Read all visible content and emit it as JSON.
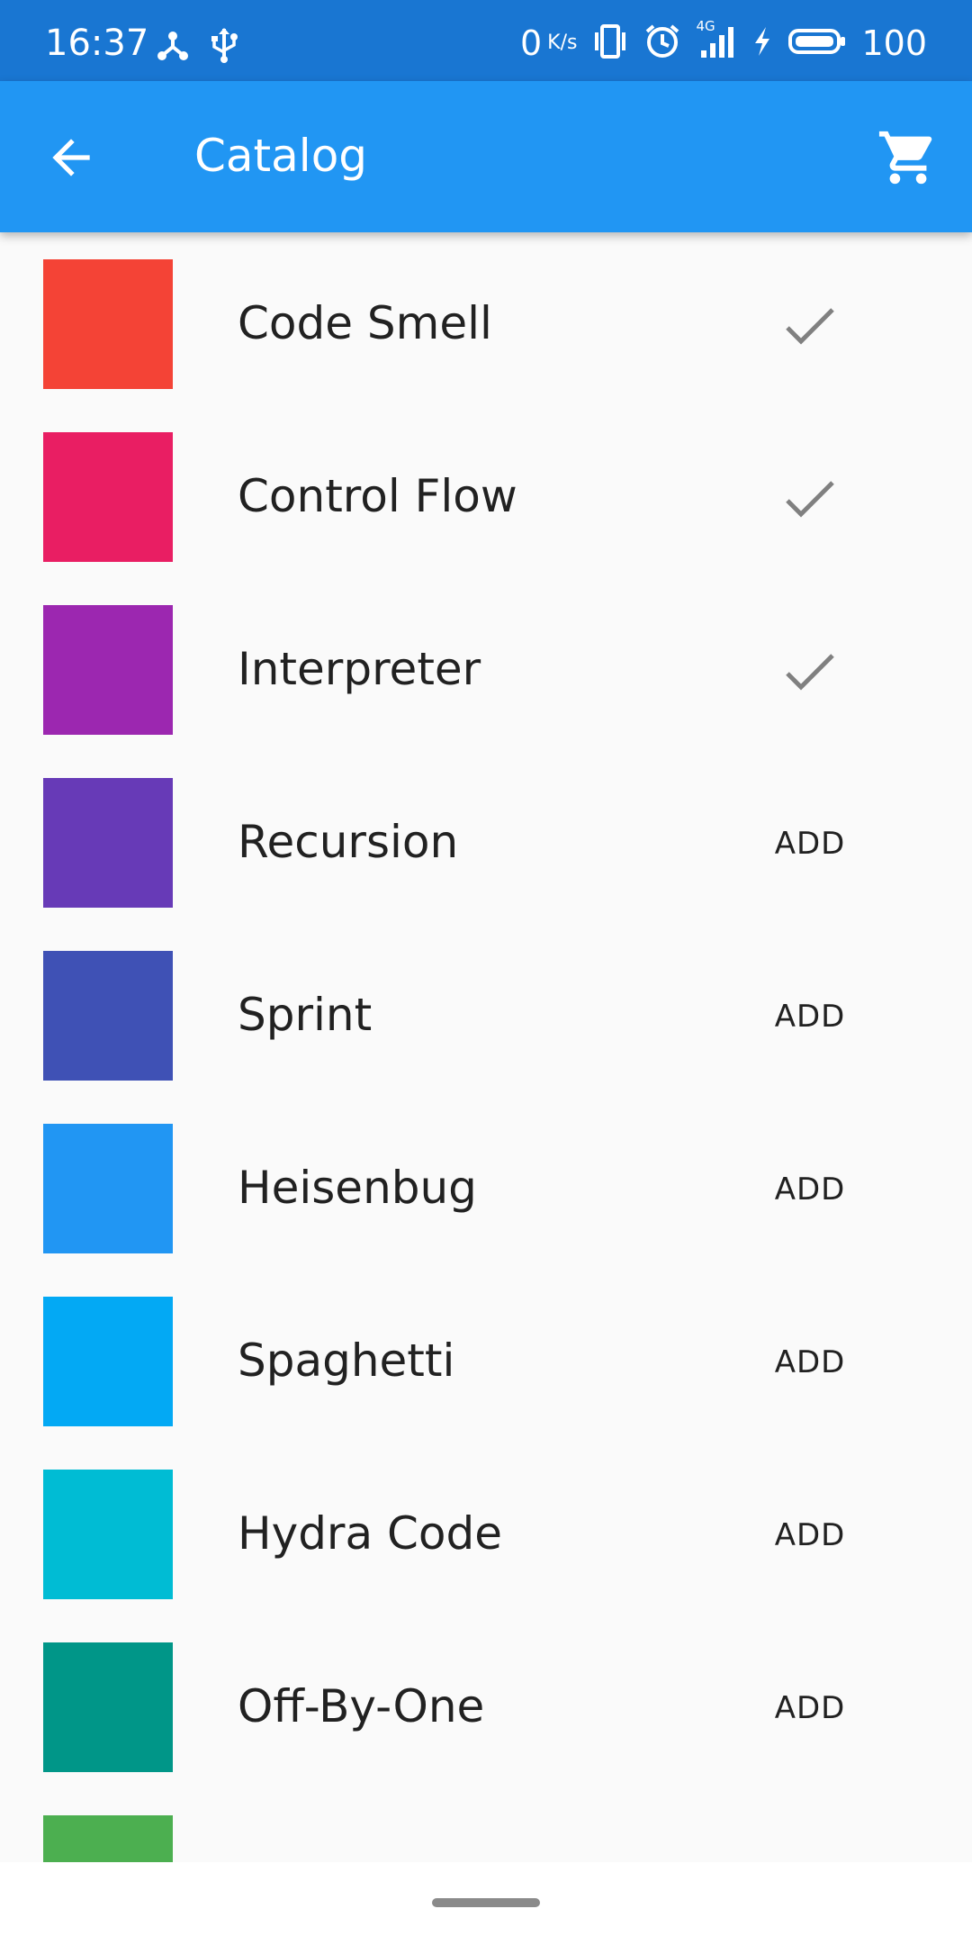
{
  "status_bar": {
    "time": "16:37",
    "net_speed_value": "0",
    "net_speed_unit": "K/s",
    "network_type": "4G",
    "battery": "100",
    "left_icons": [
      "hub-icon",
      "usb-icon"
    ],
    "right_icons": [
      "vibrate-icon",
      "alarm-icon",
      "signal-icon",
      "charging-icon",
      "battery-icon"
    ]
  },
  "app_bar": {
    "title": "Catalog",
    "back_icon": "arrow-back-icon",
    "cart_icon": "shopping-cart-icon"
  },
  "catalog": {
    "add_label": "ADD",
    "items": [
      {
        "name": "Code Smell",
        "color": "#f44336",
        "in_cart": true
      },
      {
        "name": "Control Flow",
        "color": "#e91e63",
        "in_cart": true
      },
      {
        "name": "Interpreter",
        "color": "#9c27b0",
        "in_cart": true
      },
      {
        "name": "Recursion",
        "color": "#673ab7",
        "in_cart": false
      },
      {
        "name": "Sprint",
        "color": "#3f51b5",
        "in_cart": false
      },
      {
        "name": "Heisenbug",
        "color": "#2196f3",
        "in_cart": false
      },
      {
        "name": "Spaghetti",
        "color": "#03a9f4",
        "in_cart": false
      },
      {
        "name": "Hydra Code",
        "color": "#00bcd4",
        "in_cart": false
      },
      {
        "name": "Off-By-One",
        "color": "#009688",
        "in_cart": false
      },
      {
        "name": "",
        "color": "#4caf50",
        "in_cart": false
      }
    ]
  },
  "colors": {
    "status_bar": "#1976d2",
    "app_bar": "#2196f3",
    "background": "#fafafa",
    "text": "#212121",
    "check": "#808080"
  }
}
